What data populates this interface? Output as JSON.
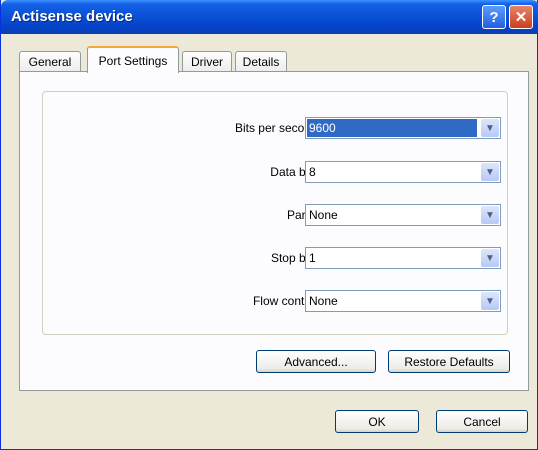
{
  "window": {
    "title": "Actisense device",
    "help_glyph": "?",
    "close_glyph": "✕"
  },
  "tabs": [
    {
      "label": "General"
    },
    {
      "label": "Port Settings"
    },
    {
      "label": "Driver"
    },
    {
      "label": "Details"
    }
  ],
  "settings": {
    "bits_per_second": {
      "label": "Bits per second:",
      "value": "9600"
    },
    "data_bits": {
      "label": "Data bits:",
      "value": "8"
    },
    "parity": {
      "label": "Parity:",
      "value": "None"
    },
    "stop_bits": {
      "label": "Stop bits:",
      "value": "1"
    },
    "flow_control": {
      "label": "Flow control:",
      "value": "None"
    }
  },
  "buttons": {
    "advanced": "Advanced...",
    "restore_defaults": "Restore Defaults",
    "ok": "OK",
    "cancel": "Cancel"
  },
  "icons": {
    "dropdown_arrow": "chevron-down-icon"
  },
  "colors": {
    "titlebar": "#0a53d8",
    "selection": "#316ac5",
    "active_tab_accent": "#f3a933"
  }
}
